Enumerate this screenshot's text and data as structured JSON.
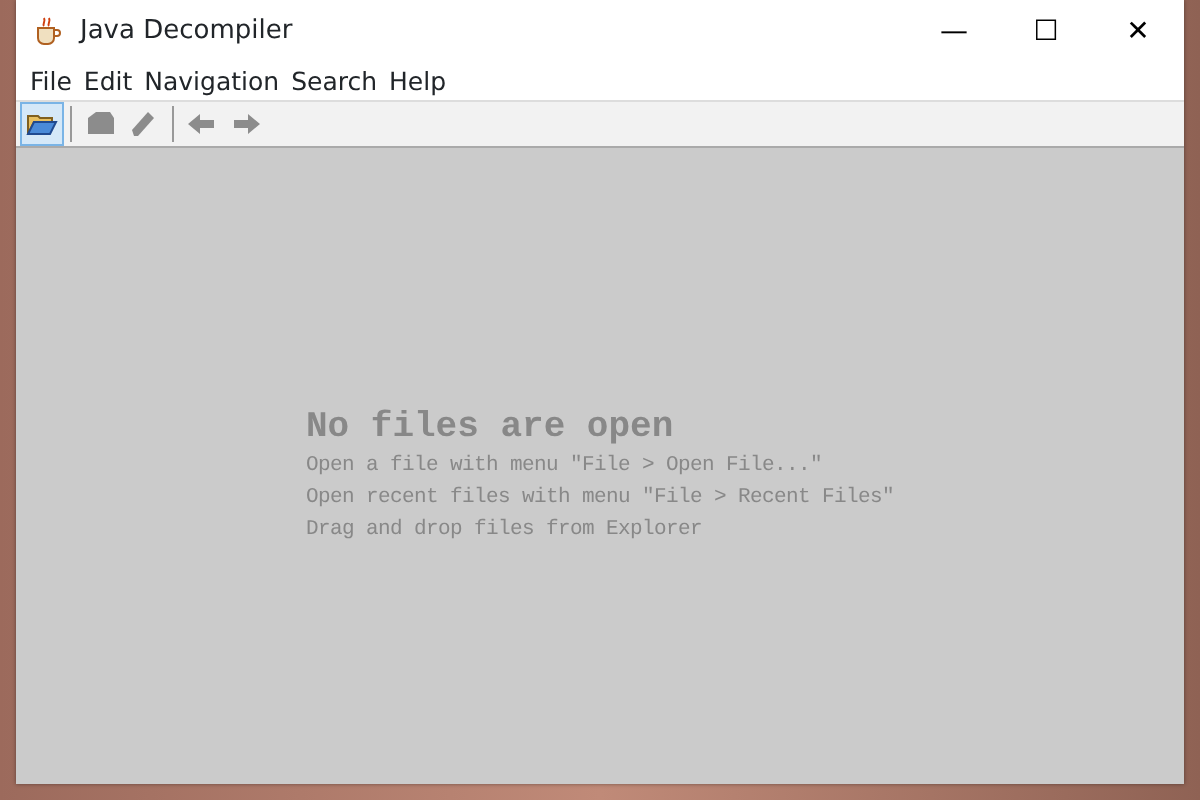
{
  "window": {
    "title": "Java Decompiler",
    "controls": [
      "—",
      "☐",
      "✕"
    ]
  },
  "menu": [
    "File",
    "Edit",
    "Navigation",
    "Search",
    "Help"
  ],
  "toolbar": [
    {
      "kind": "open",
      "disabled": false,
      "highlighted": true
    },
    {
      "kind": "separator"
    },
    {
      "kind": "save",
      "disabled": true,
      "highlighted": false
    },
    {
      "kind": "edit",
      "disabled": true,
      "highlighted": false
    },
    {
      "kind": "separator"
    },
    {
      "kind": "back",
      "disabled": true,
      "highlighted": false
    },
    {
      "kind": "forward",
      "disabled": true,
      "highlighted": false
    }
  ],
  "empty_state": {
    "heading": "No files are open",
    "lines": [
      "Open a file with menu \"File > Open File...\"",
      "Open recent files with menu \"File > Recent Files\"",
      "Drag and drop files from Explorer"
    ]
  }
}
